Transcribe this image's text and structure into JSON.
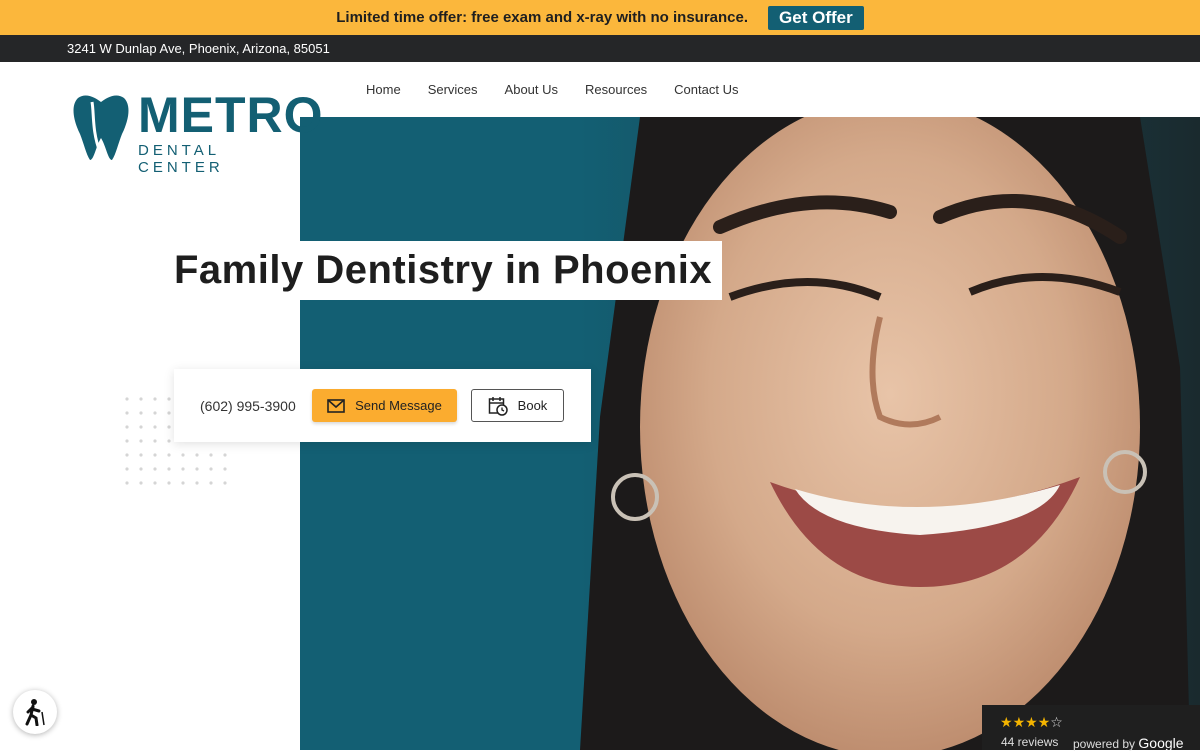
{
  "promo": {
    "text": "Limited time offer: free exam and x-ray with no insurance.",
    "button": "Get Offer"
  },
  "address": "3241 W Dunlap Ave, Phoenix, Arizona, 85051",
  "logo": {
    "title": "METRO",
    "subtitle": "DENTAL CENTER"
  },
  "nav": [
    "Home",
    "Services",
    "About Us",
    "Resources",
    "Contact Us"
  ],
  "hero": {
    "headline": "Family Dentistry in Phoenix"
  },
  "cta": {
    "phone": "(602) 995-3900",
    "message_label": "Send Message",
    "book_label": "Book",
    "message_icon": "envelope-icon",
    "book_icon": "calendar-clock-icon"
  },
  "accessibility_icon": "accessibility-icon",
  "reviews": {
    "rating": 4,
    "max_rating": 5,
    "count_label": "44 reviews",
    "powered_label": "powered by",
    "brand": "Google"
  },
  "colors": {
    "accent_yellow": "#fbb73c",
    "brand_teal": "#135f73",
    "dark_bar": "#252628"
  }
}
